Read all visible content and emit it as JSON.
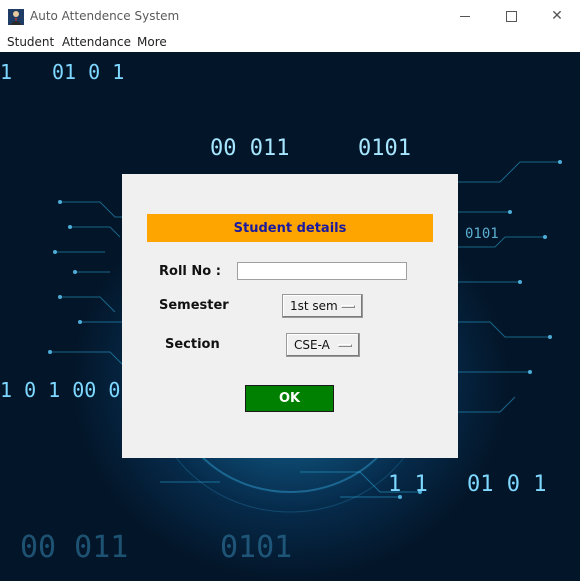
{
  "window": {
    "title": "Auto Attendence System",
    "minimize_icon": "minimize-icon",
    "maximize_icon": "maximize-icon",
    "close_glyph": "✕"
  },
  "menu": {
    "items": [
      "Student",
      "Attendance",
      "More"
    ]
  },
  "background": {
    "binary_text": [
      "1",
      "01 0 1",
      "00 011",
      "0101",
      "0101",
      "1 0 1 00 0",
      "1 1",
      "01 0 1",
      "00 011",
      "0101"
    ]
  },
  "dialog": {
    "header": "Student details",
    "roll_label": "Roll No :",
    "roll_value": "",
    "semester_label": "Semester",
    "semester_value": "1st sem",
    "section_label": "Section",
    "section_value": "CSE-A",
    "ok_label": "OK"
  },
  "colors": {
    "header_bg": "#ffa500",
    "header_text": "#1a1aa0",
    "ok_bg": "#008000",
    "dialog_bg": "#f0f0f0"
  }
}
